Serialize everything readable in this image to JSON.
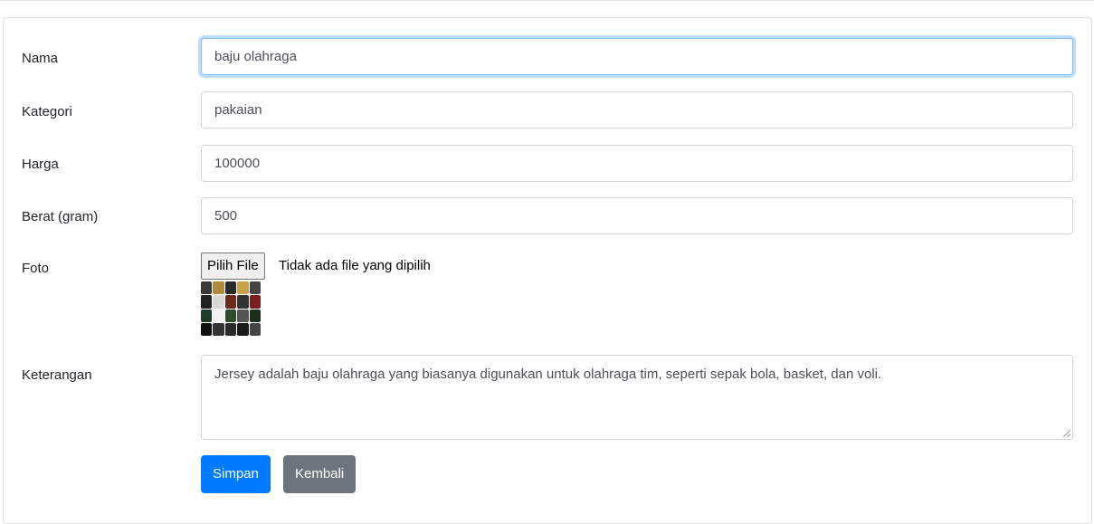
{
  "form": {
    "fields": [
      {
        "label": "Nama",
        "value": "baju olahraga"
      },
      {
        "label": "Kategori",
        "value": "pakaian"
      },
      {
        "label": "Harga",
        "value": "100000"
      },
      {
        "label": "Berat (gram)",
        "value": "500"
      }
    ],
    "photo": {
      "label": "Foto",
      "button_label": "Pilih File",
      "status_text": "Tidak ada file yang dipilih"
    },
    "description": {
      "label": "Keterangan",
      "value": "Jersey adalah baju olahraga yang biasanya digunakan untuk olahraga tim, seperti sepak bola, basket, dan voli."
    },
    "buttons": {
      "save_label": "Simpan",
      "back_label": "Kembali"
    }
  },
  "colors": {
    "primary": "#007bff",
    "secondary": "#6c757d",
    "focus_border": "#80bdff"
  }
}
